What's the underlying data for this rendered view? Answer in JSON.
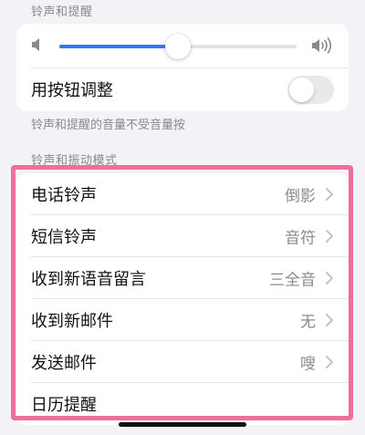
{
  "sections": {
    "ringtone_header": "铃声和提醒",
    "ringtone_footer": "铃声和提醒的音量不受音量按",
    "sound_patterns_header": "铃声和振动模式"
  },
  "volume": {
    "level_fraction": 0.5,
    "min_icon": "speaker-low-icon",
    "max_icon": "speaker-high-icon"
  },
  "change_with_buttons": {
    "label": "用按钮调整",
    "enabled": false
  },
  "sound_list": [
    {
      "label": "电话铃声",
      "value": "倒影"
    },
    {
      "label": "短信铃声",
      "value": "音符"
    },
    {
      "label": "收到新语音留言",
      "value": "三全音"
    },
    {
      "label": "收到新邮件",
      "value": "无"
    },
    {
      "label": "发送邮件",
      "value": "嗖"
    },
    {
      "label": "日历提醒",
      "value": ""
    }
  ],
  "colors": {
    "accent": "#3478f6",
    "highlight_frame": "#ee6f9a",
    "background": "#f2f2f7",
    "secondary_text": "#8a8a8e"
  }
}
